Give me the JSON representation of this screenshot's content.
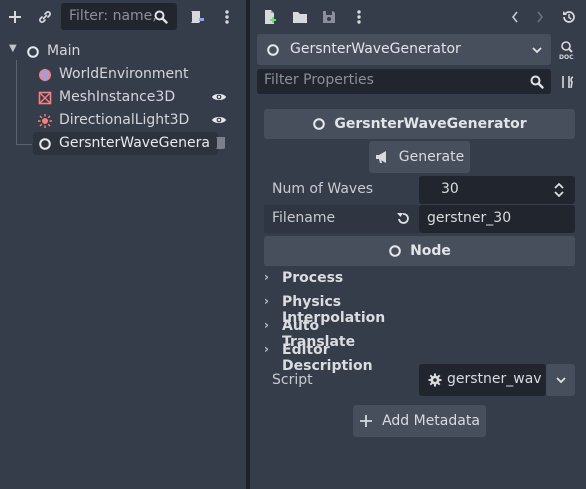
{
  "scene": {
    "filter_placeholder": "Filter: name,",
    "root": {
      "label": "Main"
    },
    "nodes": [
      {
        "label": "WorldEnvironment",
        "icon": "world-environment-icon"
      },
      {
        "label": "MeshInstance3D",
        "icon": "mesh-instance-icon"
      },
      {
        "label": "DirectionalLight3D",
        "icon": "directional-light-icon"
      },
      {
        "label": "GersnterWaveGenera",
        "icon": "node-icon",
        "selected": true
      }
    ]
  },
  "inspector": {
    "object_name": "GersnterWaveGenerator",
    "filter_placeholder": "Filter Properties",
    "header_label": "GersnterWaveGenerator",
    "generate_label": "Generate",
    "props": {
      "num_waves_label": "Num of Waves",
      "num_waves_value": "30",
      "filename_label": "Filename",
      "filename_value": "gerstner_30"
    },
    "node_section_label": "Node",
    "groups": [
      {
        "label": "Process"
      },
      {
        "label": "Physics Interpolation"
      },
      {
        "label": "Auto Translate"
      },
      {
        "label": "Editor Description"
      }
    ],
    "script_label": "Script",
    "script_value": "gerstner_wav",
    "add_metadata_label": "Add Metadata"
  },
  "colors": {
    "panel": "#363d4a",
    "field": "#21262e",
    "button": "#474f5c",
    "divider": "#1d2128",
    "selected_row": "#2d333d",
    "accent_red": "#fc7f7f",
    "accent_blue": "#8da5f3"
  }
}
